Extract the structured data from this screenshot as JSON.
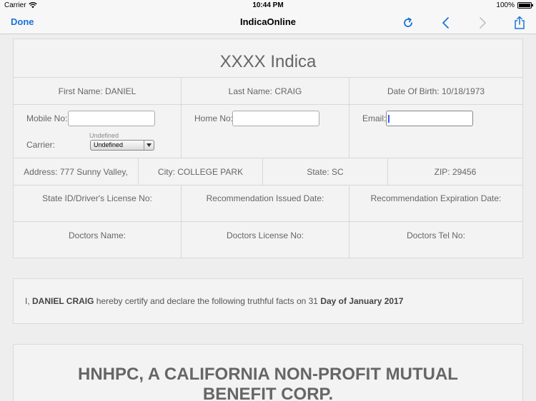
{
  "status_bar": {
    "carrier": "Carrier",
    "time": "10:44 PM",
    "battery": "100%"
  },
  "nav": {
    "done_label": "Done",
    "title": "IndicaOnline"
  },
  "form": {
    "title": "XXXX Indica",
    "first_name": "First Name: DANIEL",
    "last_name": "Last Name: CRAIG",
    "dob": "Date Of Birth: 10/18/1973",
    "mobile_label": "Mobile No:",
    "home_label": "Home No:",
    "email_label": "Email:",
    "carrier_label": "Carrier:",
    "carrier_hint": "Undefined",
    "carrier_value": "Undefined",
    "address": "Address: 777 Sunny Valley,",
    "city": "City: COLLEGE PARK",
    "state": "State: SC",
    "zip": "ZIP: 29456",
    "state_id_label": "State ID/Driver's License No:",
    "rec_issued_label": "Recommendation Issued Date:",
    "rec_expiration_label": "Recommendation Expiration Date:",
    "doctors_name_label": "Doctors Name:",
    "doctors_license_label": "Doctors License No:",
    "doctors_tel_label": "Doctors Tel No:"
  },
  "certification": {
    "prefix": "I, ",
    "name": "DANIEL CRAIG",
    "middle": " hereby certify and declare the following truthful facts on 31 ",
    "date": "Day of January 2017"
  },
  "corp": {
    "title": "HNHPC, A CALIFORNIA NON-PROFIT MUTUAL BENEFIT CORP."
  },
  "colors": {
    "accent": "#1a73d9"
  }
}
